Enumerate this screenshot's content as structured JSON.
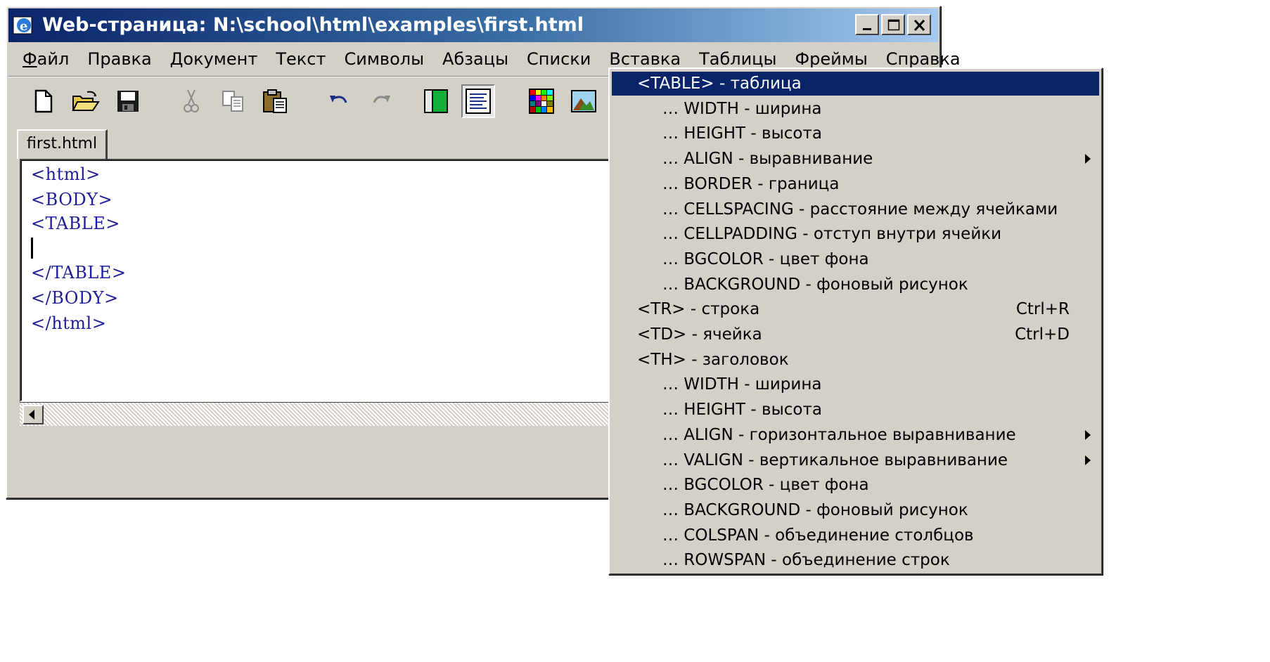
{
  "window": {
    "title": "Web-страница: N:\\school\\html\\examples\\first.html"
  },
  "menubar": [
    {
      "ul": "Ф",
      "rest": "айл"
    },
    {
      "ul": "",
      "rest": "Правка"
    },
    {
      "ul": "",
      "rest": "Документ"
    },
    {
      "ul": "",
      "rest": "Текст"
    },
    {
      "ul": "",
      "rest": "Символы"
    },
    {
      "ul": "",
      "rest": "Абзацы"
    },
    {
      "ul": "",
      "rest": "Списки"
    },
    {
      "ul": "",
      "rest": "Вставка"
    },
    {
      "ul": "",
      "rest": "Таблицы"
    },
    {
      "ul": "",
      "rest": "Фреймы"
    },
    {
      "ul": "",
      "rest": "Справка"
    }
  ],
  "toolbar": {
    "icons": [
      "new-document-icon",
      "open-folder-icon",
      "save-icon",
      "cut-icon",
      "copy-icon",
      "paste-icon",
      "undo-icon",
      "redo-icon",
      "source-view-icon",
      "text-view-icon",
      "color-palette-icon",
      "insert-image-icon"
    ]
  },
  "tab": {
    "label": "first.html"
  },
  "editor": {
    "lines": [
      "<html>",
      "<BODY>",
      "<TABLE>",
      "",
      "</TABLE>",
      "</BODY>",
      "</html>"
    ]
  },
  "popup": {
    "items": [
      {
        "label": "<TABLE> - таблица",
        "shortcut": "",
        "sub": false,
        "arrow": false,
        "selected": true
      },
      {
        "label": "… WIDTH - ширина",
        "shortcut": "",
        "sub": true,
        "arrow": false
      },
      {
        "label": "… HEIGHT - высота",
        "shortcut": "",
        "sub": true,
        "arrow": false
      },
      {
        "label": "… ALIGN - выравнивание",
        "shortcut": "",
        "sub": true,
        "arrow": true
      },
      {
        "label": "… BORDER - граница",
        "shortcut": "",
        "sub": true,
        "arrow": false
      },
      {
        "label": "… CELLSPACING - расстояние между ячейками",
        "shortcut": "",
        "sub": true,
        "arrow": false
      },
      {
        "label": "… CELLPADDING - отступ внутри ячейки",
        "shortcut": "",
        "sub": true,
        "arrow": false
      },
      {
        "label": "… BGCOLOR - цвет фона",
        "shortcut": "",
        "sub": true,
        "arrow": false
      },
      {
        "label": "… BACKGROUND - фоновый рисунок",
        "shortcut": "",
        "sub": true,
        "arrow": false
      },
      {
        "label": "<TR> - строка",
        "shortcut": "Ctrl+R",
        "sub": false,
        "arrow": false
      },
      {
        "label": "<TD> - ячейка",
        "shortcut": "Ctrl+D",
        "sub": false,
        "arrow": false
      },
      {
        "label": "<TH> - заголовок",
        "shortcut": "",
        "sub": false,
        "arrow": false
      },
      {
        "label": "… WIDTH - ширина",
        "shortcut": "",
        "sub": true,
        "arrow": false
      },
      {
        "label": "… HEIGHT - высота",
        "shortcut": "",
        "sub": true,
        "arrow": false
      },
      {
        "label": "… ALIGN - горизонтальное выравнивание",
        "shortcut": "",
        "sub": true,
        "arrow": true
      },
      {
        "label": "… VALIGN - вертикальное выравнивание",
        "shortcut": "",
        "sub": true,
        "arrow": true
      },
      {
        "label": "… BGCOLOR - цвет фона",
        "shortcut": "",
        "sub": true,
        "arrow": false
      },
      {
        "label": "… BACKGROUND - фоновый рисунок",
        "shortcut": "",
        "sub": true,
        "arrow": false
      },
      {
        "label": "… COLSPAN - объединение столбцов",
        "shortcut": "",
        "sub": true,
        "arrow": false
      },
      {
        "label": "… ROWSPAN - объединение строк",
        "shortcut": "",
        "sub": true,
        "arrow": false
      }
    ]
  },
  "colors": {
    "title_start": "#0a246a",
    "title_end": "#a6caf0",
    "selection": "#0a246a",
    "code_text": "#1d1d9c",
    "face": "#d4d0c8"
  }
}
